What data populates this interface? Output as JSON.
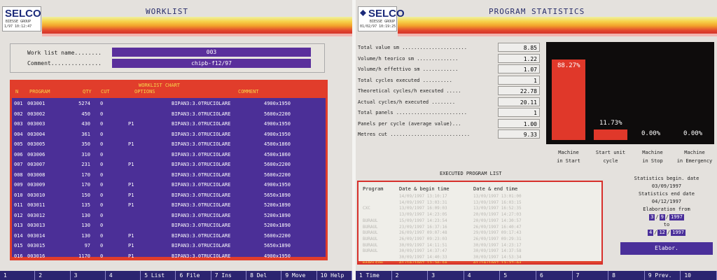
{
  "worklist": {
    "logo": {
      "brand": "SELCO",
      "subtitle": "BIESSE GROUP",
      "date": "1/97  10:12:47"
    },
    "title": "WORKLIST",
    "name_label": "Work list name........",
    "name_value": "003",
    "comment_label": "Comment...............",
    "comment_value": "chipb-f12/97",
    "table": {
      "header_chart": "WORKLIST CHART",
      "columns": {
        "n": "N",
        "program": "PROGRAM",
        "qty": "QTY",
        "cut": "CUT",
        "options": "OPTIONS",
        "comment": "COMMENT"
      },
      "rows": [
        {
          "n": "001",
          "program": "003001",
          "qty": "5274",
          "cut": "0",
          "options": "",
          "comment": "BIPAN3:3.0TRUCIOLARE",
          "size": "4900x1950"
        },
        {
          "n": "002",
          "program": "003002",
          "qty": "450",
          "cut": "0",
          "options": "",
          "comment": "BIPAN3:3.0TRUCIOLARE",
          "size": "5600x2200"
        },
        {
          "n": "003",
          "program": "003003",
          "qty": "430",
          "cut": "0",
          "options": "P1",
          "comment": "BIPAN3:3.0TRUCIOLARE",
          "size": "4900x1950"
        },
        {
          "n": "004",
          "program": "003004",
          "qty": "361",
          "cut": "0",
          "options": "",
          "comment": "BIPAN3:3.0TRUCIOLARE",
          "size": "4900x1950"
        },
        {
          "n": "005",
          "program": "003005",
          "qty": "350",
          "cut": "0",
          "options": "P1",
          "comment": "BIPAN3:3.0TRUCIOLARE",
          "size": "4500x1860"
        },
        {
          "n": "006",
          "program": "003006",
          "qty": "310",
          "cut": "0",
          "options": "",
          "comment": "BIPAN3:3.0TRUCIOLARE",
          "size": "4500x1860"
        },
        {
          "n": "007",
          "program": "003007",
          "qty": "231",
          "cut": "0",
          "options": "P1",
          "comment": "BIPAN3:3.0TRUCIOLARE",
          "size": "5600x2200"
        },
        {
          "n": "008",
          "program": "003008",
          "qty": "170",
          "cut": "0",
          "options": "",
          "comment": "BIPAN3:3.0TRUCIOLARE",
          "size": "5600x2200"
        },
        {
          "n": "009",
          "program": "003009",
          "qty": "170",
          "cut": "0",
          "options": "P1",
          "comment": "BIPAN3:3.0TRUCIOLARE",
          "size": "4900x1950"
        },
        {
          "n": "010",
          "program": "003010",
          "qty": "150",
          "cut": "0",
          "options": "P1",
          "comment": "BIPAN3:3.0TRUCIOLARE",
          "size": "5650x1890"
        },
        {
          "n": "011",
          "program": "003011",
          "qty": "135",
          "cut": "0",
          "options": "P1",
          "comment": "BIPAN3:3.0TRUCIOLARE",
          "size": "5200x1890"
        },
        {
          "n": "012",
          "program": "003012",
          "qty": "130",
          "cut": "0",
          "options": "",
          "comment": "BIPAN3:3.0TRUCIOLARE",
          "size": "5200x1890"
        },
        {
          "n": "013",
          "program": "003013",
          "qty": "130",
          "cut": "0",
          "options": "",
          "comment": "BIPAN3:3.0TRUCIOLARE",
          "size": "5200x1890"
        },
        {
          "n": "014",
          "program": "003014",
          "qty": "130",
          "cut": "0",
          "options": "P1",
          "comment": "BIPAN3:3.0TRUCIOLARE",
          "size": "5600x2200"
        },
        {
          "n": "015",
          "program": "003015",
          "qty": "97",
          "cut": "0",
          "options": "P1",
          "comment": "BIPAN3:3.0TRUCIOLARE",
          "size": "5650x1890"
        },
        {
          "n": "016",
          "program": "003016",
          "qty": "1170",
          "cut": "0",
          "options": "P1",
          "comment": "BIPAN3:3.0TRUCIOLARE",
          "size": "4900x1950"
        }
      ]
    },
    "fkeys": [
      "1",
      "2",
      "3",
      "4",
      "5 List",
      "6 File",
      "7 Ins",
      "8 Del",
      "9 Move",
      "10 Help"
    ]
  },
  "stats": {
    "logo": {
      "brand": "SELCO",
      "subtitle": "BIESSE GROUP",
      "date": "01/02/97  10:19:25"
    },
    "title": "PROGRAM STATISTICS",
    "items": [
      {
        "label": "Total value sm ......................",
        "value": "8.85"
      },
      {
        "label": "Volume/h teorico sm ..............",
        "value": "1.22"
      },
      {
        "label": "Volume/h effettivo sm ............",
        "value": "1.07"
      },
      {
        "label": "Total cycles executed ..........",
        "value": "1"
      },
      {
        "label": "Theoretical cycles/h executed .....",
        "value": "22.78"
      },
      {
        "label": "Actual cycles/h executed ........",
        "value": "20.11"
      },
      {
        "label": "Total panels ........................",
        "value": "1"
      },
      {
        "label": "Panels per cycle (average value)...",
        "value": "1.00"
      },
      {
        "label": "Metres cut ...........................",
        "value": "9.33"
      }
    ],
    "chart_data": {
      "type": "bar",
      "categories": [
        "Machine in Start",
        "Start unit cycle",
        "Machine in Stop",
        "Machine in Emergency"
      ],
      "values": [
        88.27,
        11.73,
        0.0,
        0.0
      ],
      "labels": [
        "88.27%",
        "11.73%",
        "0.00%",
        "0.00%"
      ],
      "ylim": [
        0,
        100
      ]
    },
    "captions": [
      "Machine\nin Start",
      "Start unit\ncycle",
      "Machine\nin Stop",
      "Machine\nin Emergency"
    ],
    "list_title": "EXECUTED PROGRAM LIST",
    "list_headers": {
      "program": "Program",
      "begin": "Date & begin time",
      "end": "Date & end time"
    },
    "list_rows": [
      {
        "program": "",
        "begin": "14/09/1997  13:10:17",
        "end": "13/09/1997  13:01:00"
      },
      {
        "program": "",
        "begin": "14/09/1997  13:03:31",
        "end": "13/09/1997  16:03:15"
      },
      {
        "program": "CXC",
        "begin": "13/09/1997  16:09:03",
        "end": "13/09/1997  16:52:35"
      },
      {
        "program": "",
        "begin": "13/09/1997  14:23:05",
        "end": "20/09/1997  14:27:03"
      },
      {
        "program": "BURAUL",
        "begin": "15/09/1997  14:23:54",
        "end": "20/09/1997  14:30:57"
      },
      {
        "program": "BURAUL",
        "begin": "23/09/1997  16:37:16",
        "end": "26/09/1997  16:40:47"
      },
      {
        "program": "BURAUL",
        "begin": "26/09/1997  09:07:48",
        "end": "29/09/1997  09:17:43"
      },
      {
        "program": "BURAUL",
        "begin": "26/09/1997  09:23:03",
        "end": "26/09/1997  09:29:31"
      },
      {
        "program": "BURAUL",
        "begin": "30/09/1997  14:11:51",
        "end": "30/09/1997  14:23:17"
      },
      {
        "program": "BURAUL",
        "begin": "30/09/1997  14:37:47",
        "end": "30/09/1997  14:37:58"
      },
      {
        "program": "",
        "begin": "30/09/1997  14:40:33",
        "end": "30/09/1997  14:53:34"
      }
    ],
    "selected_row": {
      "program": "NAPOLEON",
      "begin": "01/10/1997  13:30:50",
      "end": "01/10/1997  13:37:04"
    },
    "info": {
      "begin_label": "Statistics begin. date",
      "begin_date": "03/09/1997",
      "end_label": "Statistics end date",
      "end_date": "04/12/1997",
      "elab_label": "Elaboration from",
      "from": [
        "3",
        "9",
        "1997"
      ],
      "to_label": "to",
      "to": [
        "4",
        "12",
        "1997"
      ],
      "button": "Elabor."
    },
    "fkeys": [
      "1 Time",
      "2",
      "3",
      "4",
      "5",
      "6",
      "7",
      "8",
      "9 Prev.",
      "10"
    ]
  }
}
